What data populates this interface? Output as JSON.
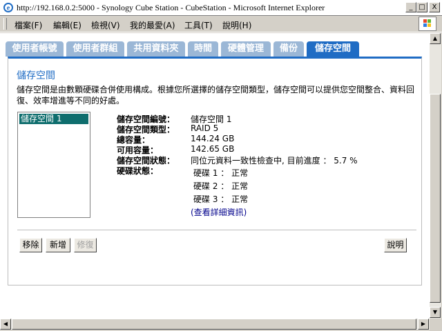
{
  "window": {
    "title": "http://192.168.0.2:5000 - Synology Cube Station - CubeStation - Microsoft Internet Explorer",
    "minimize_label": "_",
    "maximize_label": "□",
    "close_label": "X"
  },
  "menu": {
    "items": [
      {
        "label": "檔案(F)"
      },
      {
        "label": "編輯(E)"
      },
      {
        "label": "檢視(V)"
      },
      {
        "label": "我的最愛(A)"
      },
      {
        "label": "工具(T)"
      },
      {
        "label": "說明(H)"
      }
    ]
  },
  "tabs": [
    {
      "label": "使用者帳號"
    },
    {
      "label": "使用者群組"
    },
    {
      "label": "共用資料夾"
    },
    {
      "label": "時間"
    },
    {
      "label": "硬體管理"
    },
    {
      "label": "備份"
    },
    {
      "label": "儲存空間",
      "active": true
    }
  ],
  "page": {
    "heading": "儲存空間",
    "description": "儲存空間是由數顆硬碟合併使用構成。根據您所選擇的儲存空間類型，儲存空間可以提供您空間整合、資料回復、效率增進等不同的好處。"
  },
  "list": {
    "items": [
      "儲存空間 1"
    ]
  },
  "details": {
    "rows": [
      {
        "label": "儲存空間編號：",
        "value": "儲存空間 1"
      },
      {
        "label": "儲存空間類型：",
        "value": "RAID 5"
      },
      {
        "label": "總容量：",
        "value": "144.24 GB"
      },
      {
        "label": "可用容量：",
        "value": "142.65 GB"
      },
      {
        "label": "儲存空間狀態：",
        "value": "同位元資料一致性檢查中, 目前進度 ： 5.7 %"
      }
    ],
    "disk_label": "硬碟狀態：",
    "disks": [
      "硬碟 1 ： 正常",
      "硬碟 2 ： 正常",
      "硬碟 3 ： 正常"
    ],
    "detail_link": "(查看詳細資訊)"
  },
  "buttons": {
    "remove": "移除",
    "add": "新增",
    "repair": "修復",
    "help": "說明"
  },
  "colors": {
    "accent": "#1f6cc4",
    "tab_inactive": "#9bb7d6",
    "selection": "#0f6e6e",
    "link": "#00008b"
  }
}
